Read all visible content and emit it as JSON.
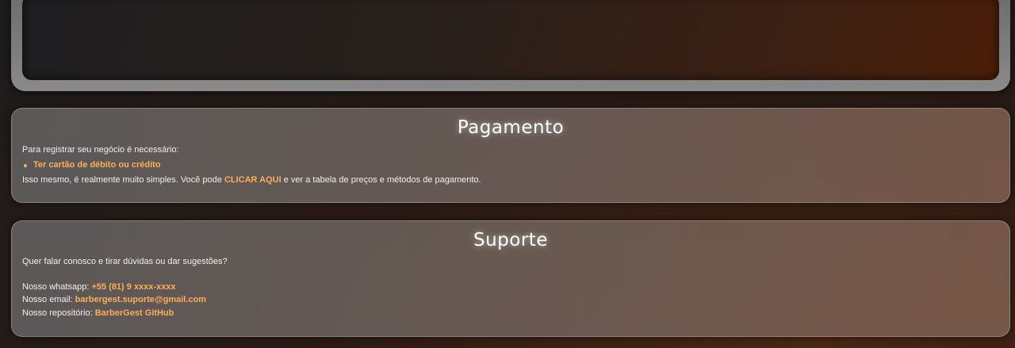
{
  "pagamento": {
    "title": "Pagamento",
    "intro": "Para registrar seu negócio é necessário:",
    "requirement": "Ter cartão de débito ou crédito",
    "text_before_link": "Isso mesmo, é realmente muito simples. Você pode ",
    "link_label": "CLICAR AQUI",
    "text_after_link": " e ver a tabela de preços e métodos de pagamento."
  },
  "suporte": {
    "title": "Suporte",
    "question": "Quer falar conosco e tirar dúvidas ou dar sugestões?",
    "whatsapp_label": "Nosso whatsapp: ",
    "whatsapp_value": "+55 (81) 9 xxxx-xxxx",
    "email_label": "Nosso email: ",
    "email_value": "barbergest.suporte@gmail.com",
    "repo_label": "Nosso repositório: ",
    "repo_value": "BarberGest GitHub"
  },
  "colors": {
    "accent": "#ffad55",
    "text": "#f2efec"
  }
}
